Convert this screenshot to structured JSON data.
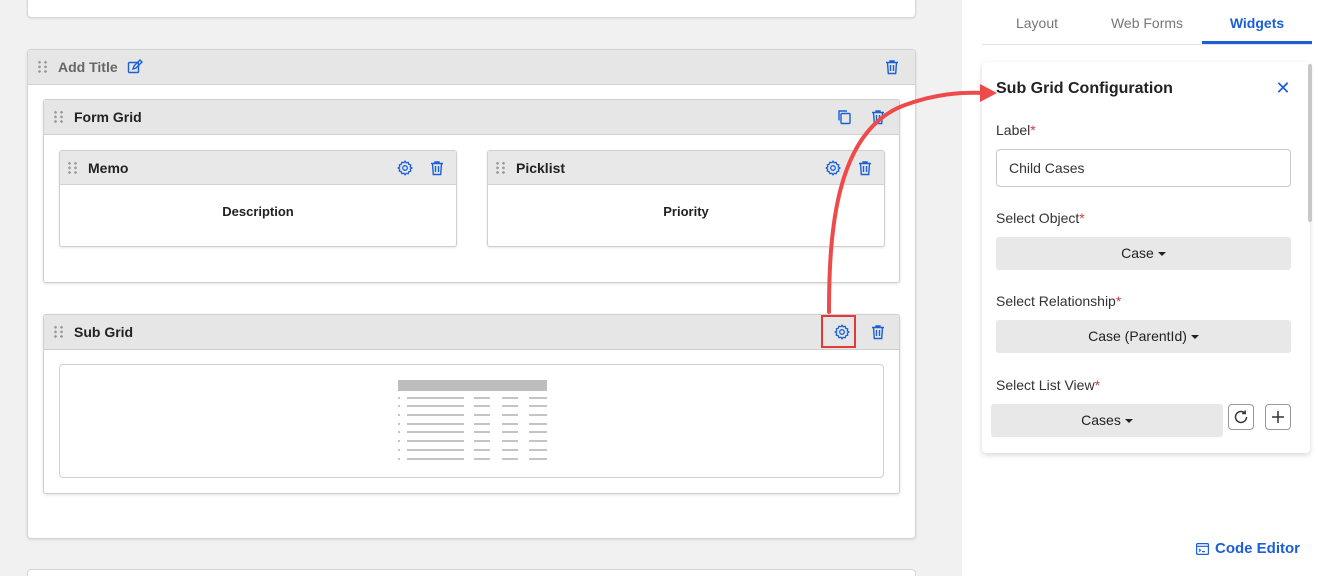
{
  "section": {
    "title": "Add Title"
  },
  "form_grid": {
    "title": "Form Grid",
    "fields": [
      {
        "title": "Memo",
        "value": "Description"
      },
      {
        "title": "Picklist",
        "value": "Priority"
      }
    ]
  },
  "sub_grid": {
    "title": "Sub Grid"
  },
  "sidebar": {
    "tabs": [
      {
        "label": "Layout"
      },
      {
        "label": "Web Forms"
      },
      {
        "label": "Widgets"
      }
    ],
    "config": {
      "title": "Sub Grid Configuration",
      "label_field": {
        "label": "Label",
        "required": "*",
        "value": "Child Cases"
      },
      "object_field": {
        "label": "Select Object",
        "required": "*",
        "value": "Case"
      },
      "relationship_field": {
        "label": "Select Relationship",
        "required": "*",
        "value": "Case (ParentId)"
      },
      "list_view_field": {
        "label": "Select List View",
        "required": "*",
        "value": "Cases"
      }
    },
    "code_editor_label": "Code Editor"
  },
  "colors": {
    "accent": "#1a5fd6",
    "highlight": "#e53935",
    "required": "#d9383a"
  },
  "icons": [
    "drag-handle-icon",
    "edit-icon",
    "trash-icon",
    "copy-icon",
    "gear-icon",
    "close-icon",
    "refresh-icon",
    "plus-icon",
    "code-editor-icon"
  ]
}
